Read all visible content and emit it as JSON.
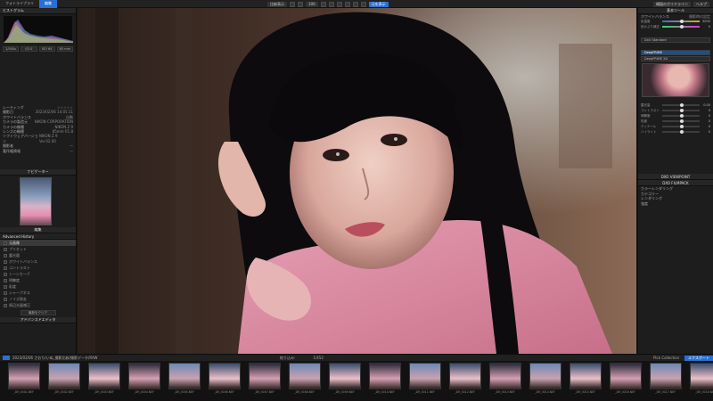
{
  "topbar": {
    "tabs": [
      "フォトライブラリ",
      "編集"
    ],
    "center_labels": [
      "比較表示",
      "100",
      "元を表示"
    ],
    "right_labels": [
      "構図のガイドライン",
      "ヘルプ"
    ]
  },
  "left_panel": {
    "histogram_title": "ヒストグラム",
    "exif_rows": [
      [
        "レーティング",
        "☆☆☆☆☆"
      ],
      [
        "撮影日",
        "2023/02/06 14:05:11"
      ],
      [
        "ホワイトバランス",
        "自動"
      ],
      [
        "カメラの製造元",
        "NIKON CORPORATION"
      ],
      [
        "カメラの機種",
        "NIKON Z 9"
      ],
      [
        "レンズの機種",
        "85mm f/1.8"
      ],
      [
        "ソフトウェアバージョン",
        "NIKON Z 9 Ver.02.00"
      ],
      [
        "撮影者",
        "—"
      ],
      [
        "著作権情報",
        "—"
      ]
    ],
    "buttons": [
      "1/500s",
      "f/2.0",
      "ISO 64",
      "85 mm"
    ],
    "navigator_title": "ナビゲーター",
    "history_title": "編集",
    "history_subtitle": "Advanced History",
    "history_items": [
      "元画像",
      "プリセット",
      "露光量",
      "ホワイトバランス",
      "コントラスト",
      "トーンカーブ",
      "明瞭度",
      "彩度",
      "シャープネス",
      "ノイズ除去",
      "周辺光量補正",
      "トリミング",
      "傾き補正"
    ],
    "footer_btn": "最新をクリア",
    "footer_title": "アドバンスドエディタ"
  },
  "right_panel": {
    "basic_title": "基本ツール",
    "wb_label": "ホワイトバランス",
    "wb_value": "撮影時の設定",
    "sliders": [
      {
        "label": "色温度",
        "value": "5000",
        "pos": 0.5
      },
      {
        "label": "色かぶり補正",
        "value": "0",
        "pos": 0.5
      }
    ],
    "presets": [
      "DxO Standard",
      "DeepPRIME",
      "DeepPRIME XD"
    ],
    "tone_sliders": [
      {
        "label": "露光量",
        "value": "0.00",
        "pos": 0.5
      },
      {
        "label": "コントラスト",
        "value": "0",
        "pos": 0.5
      },
      {
        "label": "明瞭度",
        "value": "0",
        "pos": 0.5
      },
      {
        "label": "彩度",
        "value": "0",
        "pos": 0.5
      },
      {
        "label": "ディテール",
        "value": "0",
        "pos": 0.5
      },
      {
        "label": "ハイライト",
        "value": "0",
        "pos": 0.5
      }
    ],
    "section_titles": [
      "DXO VIEWPOINT",
      "DXO FILMPACK"
    ],
    "bottom_items": [
      "カラーレンダリング",
      "カテゴリー",
      "レンダリング",
      "強度"
    ]
  },
  "bottom_bar": {
    "path": "2023/02/06 さおり/いぬ_撮影比較/撮影データ/RAW",
    "center": "絞り込み:",
    "count": "1/452",
    "collection": "Pick Collection",
    "export": "エクスポート"
  },
  "filmstrip": [
    "_D9_0001.NEF",
    "_D9_0002.NEF",
    "_D9_0003.NEF",
    "_D9_0004.NEF",
    "_D9_0005.NEF",
    "_D9_0006.NEF",
    "_D9_0007.NEF",
    "_D9_0008.NEF",
    "_D9_0009.NEF",
    "_D9_0010.NEF",
    "_D9_0011.NEF",
    "_D9_0012.NEF",
    "_D9_0013.NEF",
    "_D9_0014.NEF",
    "_D9_0015.NEF",
    "_D9_0016.NEF",
    "_D9_0017.NEF",
    "_D9_0018.NEF"
  ]
}
